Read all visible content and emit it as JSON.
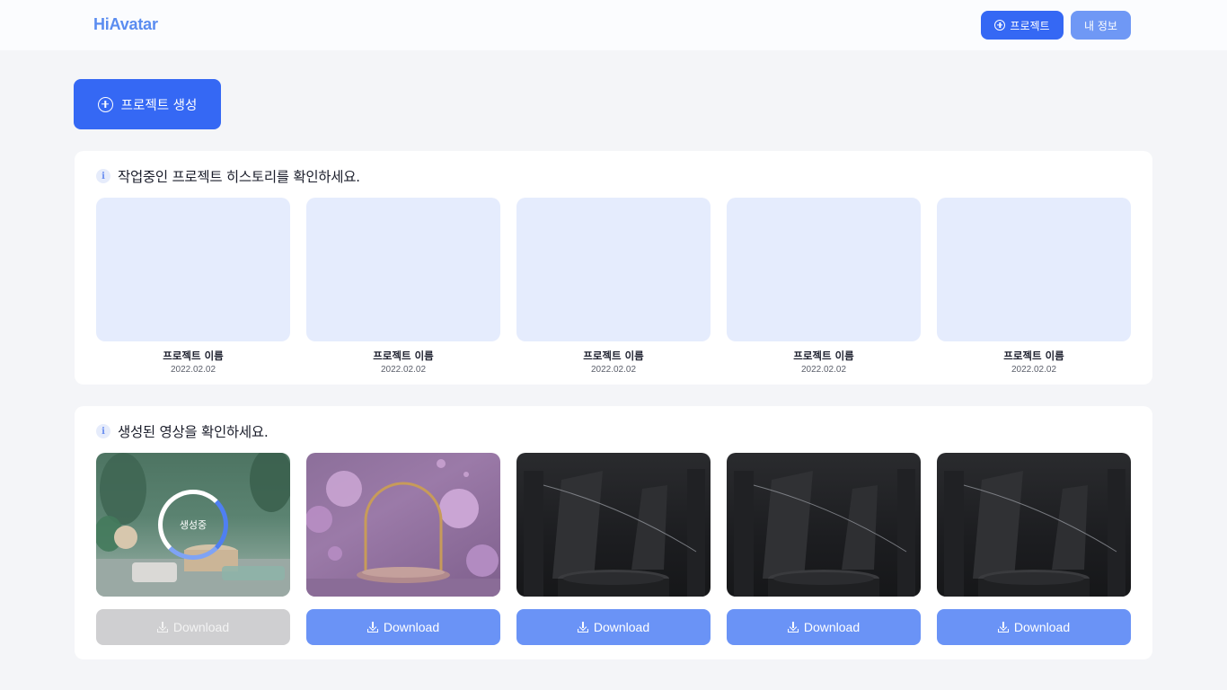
{
  "header": {
    "logo": "HiAvatar",
    "project_button": "프로젝트",
    "myinfo_button": "내 정보"
  },
  "create_button": "프로젝트 생성",
  "history": {
    "title": "작업중인 프로젝트 히스토리를 확인하세요.",
    "projects": [
      {
        "name": "프로젝트 이름",
        "date": "2022.02.02"
      },
      {
        "name": "프로젝트 이름",
        "date": "2022.02.02"
      },
      {
        "name": "프로젝트 이름",
        "date": "2022.02.02"
      },
      {
        "name": "프로젝트 이름",
        "date": "2022.02.02"
      },
      {
        "name": "프로젝트 이름",
        "date": "2022.02.02"
      }
    ]
  },
  "videos": {
    "title": "생성된 영상을 확인하세요.",
    "generating_label": "생성중",
    "download_label": "Download",
    "items": [
      {
        "status": "generating",
        "scene": "green-podium",
        "download_enabled": false
      },
      {
        "status": "done",
        "scene": "purple-arch",
        "download_enabled": true
      },
      {
        "status": "done",
        "scene": "dark-pedestal",
        "download_enabled": true
      },
      {
        "status": "done",
        "scene": "dark-pedestal",
        "download_enabled": true
      },
      {
        "status": "done",
        "scene": "dark-pedestal",
        "download_enabled": true
      }
    ]
  },
  "icons": {
    "add": "plus-circle-icon",
    "info": "info-icon",
    "download": "download-icon"
  },
  "colors": {
    "primary": "#3568f4",
    "secondary": "#6f98f5",
    "download_active": "#6a93f6",
    "download_disabled": "#cfcfd1",
    "thumb_placeholder": "#e5ecfd"
  }
}
